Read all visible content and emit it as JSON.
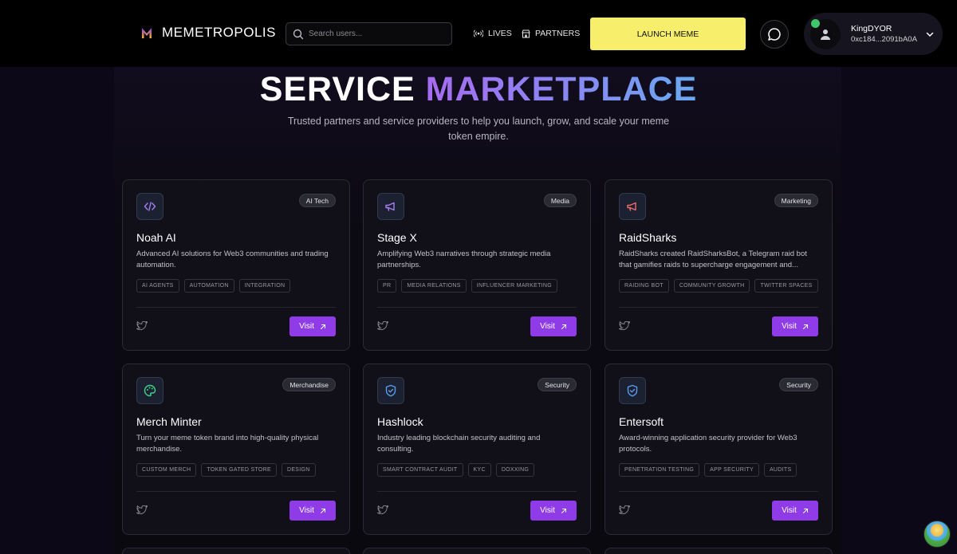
{
  "header": {
    "brand": "MEMETROPOLIS",
    "search_placeholder": "Search users...",
    "nav": [
      {
        "label": "LIVES",
        "icon": "broadcast-icon"
      },
      {
        "label": "PARTNERS",
        "icon": "store-icon"
      }
    ],
    "launch_label": "LAUNCH MEME",
    "chat_icon": "chat-bubble-icon",
    "user": {
      "name": "KingDYOR",
      "address": "0xc184...2091bA0A",
      "status_color": "#3fc56a"
    }
  },
  "hero": {
    "title_plain": "SERVICE",
    "title_accent": "MARKETPLACE",
    "subtitle": "Trusted partners and service providers to help you launch, grow, and scale your meme token empire."
  },
  "colors": {
    "accent": "#8f3ce8",
    "launch": "#f7ee6c"
  },
  "cards": [
    {
      "name": "Noah AI",
      "category": "AI Tech",
      "icon": "code-icon",
      "icon_color": "#a67df2",
      "description": "Advanced AI solutions for Web3 communities and trading automation.",
      "tags": [
        "AI AGENTS",
        "AUTOMATION",
        "INTEGRATION"
      ],
      "visit_label": "Visit"
    },
    {
      "name": "Stage X",
      "category": "Media",
      "icon": "megaphone-icon",
      "icon_color": "#a67df2",
      "description": "Amplifying Web3 narratives through strategic media partnerships.",
      "tags": [
        "PR",
        "MEDIA RELATIONS",
        "INFLUENCER MARKETING"
      ],
      "visit_label": "Visit"
    },
    {
      "name": "RaidSharks",
      "category": "Marketing",
      "icon": "megaphone-icon",
      "icon_color": "#ef6b6b",
      "description": "RaidSharks created RaidSharksBot, a Telegram raid bot that gamifies raids to supercharge engagement and...",
      "tags": [
        "RAIDING BOT",
        "COMMUNITY GROWTH",
        "TWITTER SPACES"
      ],
      "visit_label": "Visit"
    },
    {
      "name": "Merch Minter",
      "category": "Merchandise",
      "icon": "palette-icon",
      "icon_color": "#3fd48a",
      "description": "Turn your meme token brand into high-quality physical merchandise.",
      "tags": [
        "CUSTOM MERCH",
        "TOKEN GATED STORE",
        "DESIGN"
      ],
      "visit_label": "Visit"
    },
    {
      "name": "Hashlock",
      "category": "Security",
      "icon": "shield-icon",
      "icon_color": "#5a9df0",
      "description": "Industry leading blockchain security auditing and consulting.",
      "tags": [
        "SMART CONTRACT AUDIT",
        "KYC",
        "DOXXING"
      ],
      "visit_label": "Visit"
    },
    {
      "name": "Entersoft",
      "category": "Security",
      "icon": "shield-icon",
      "icon_color": "#5a9df0",
      "description": "Award-winning application security provider for Web3 protocols.",
      "tags": [
        "PENETRATION TESTING",
        "APP SECURITY",
        "AUDITS"
      ],
      "visit_label": "Visit"
    }
  ]
}
